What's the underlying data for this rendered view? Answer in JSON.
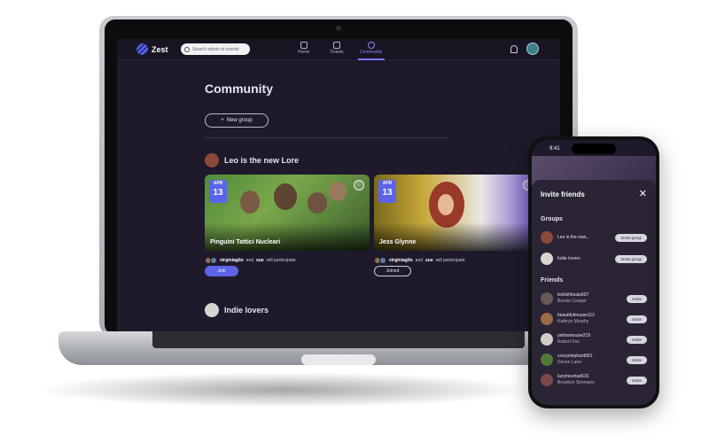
{
  "colors": {
    "accent": "#5f63e8",
    "background": "#1f1a2b",
    "sheet": "#2a2435"
  },
  "app": {
    "brand": "Zest",
    "search_placeholder": "Search artists or events",
    "nav": [
      {
        "label": "Home",
        "icon": "home-icon"
      },
      {
        "label": "Tickets",
        "icon": "ticket-icon"
      },
      {
        "label": "Community",
        "icon": "community-icon",
        "active": true
      }
    ],
    "icons": [
      "bell-icon",
      "avatar"
    ]
  },
  "community": {
    "title": "Community",
    "new_group": "New group",
    "groups": [
      {
        "name": "Leo is the new Lore",
        "events": [
          {
            "month": "APR",
            "day": "13",
            "title": "Pinguini Tattici Nucleari",
            "attendees_user1": "virginiaglio",
            "attendees_and": "and",
            "attendees_user2": "sue",
            "attendees_suffix": "will partecipate",
            "button": "Join"
          },
          {
            "month": "APR",
            "day": "13",
            "title": "Jess Glynne",
            "attendees_user1": "virginiaglio",
            "attendees_and": "and",
            "attendees_user2": "sue",
            "attendees_suffix": "will partecipate",
            "button": "Joined"
          }
        ]
      },
      {
        "name": "Indie lovers"
      }
    ]
  },
  "phone": {
    "time": "9:41",
    "sheet_title": "Invite friends",
    "groups_label": "Groups",
    "groups": [
      {
        "name": "Leo is the new...",
        "button": "Invite group"
      },
      {
        "name": "Indie lovers",
        "button": "Invite group"
      }
    ],
    "friends_label": "Friends",
    "friends": [
      {
        "user": "ticklishkoala607",
        "name": "Bessie Cooper",
        "button": "Invite"
      },
      {
        "user": "beautifulmouse112",
        "name": "Kathryn Murphy",
        "button": "Invite"
      },
      {
        "user": "yellowmouse215",
        "name": "Robert Fox",
        "button": "Invite"
      },
      {
        "user": "crazyelephant681",
        "name": "Devon Lane",
        "button": "Invite"
      },
      {
        "user": "lazymeerkat616",
        "name": "Brooklyn Simmons",
        "button": "Invite"
      }
    ]
  }
}
